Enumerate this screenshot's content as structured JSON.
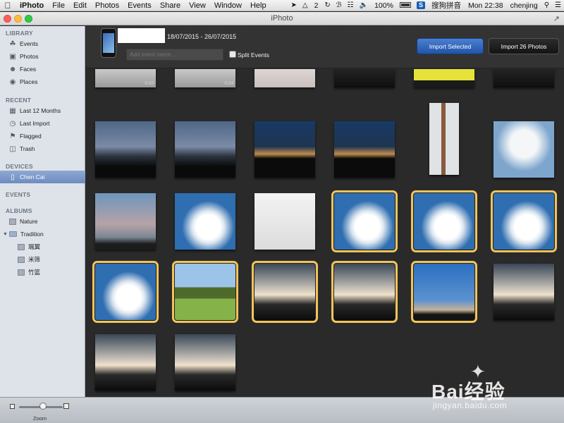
{
  "menubar": {
    "app_name": "iPhoto",
    "items": [
      "File",
      "Edit",
      "Photos",
      "Events",
      "Share",
      "View",
      "Window",
      "Help"
    ],
    "status_count": "2",
    "battery": "100%",
    "input_method": "搜狗拼音",
    "clock": "Mon 22:38",
    "user": "chenjing"
  },
  "window": {
    "title": "iPhoto"
  },
  "sidebar": {
    "library_heading": "LIBRARY",
    "library": [
      {
        "label": "Events",
        "icon": "palm-tree-icon"
      },
      {
        "label": "Photos",
        "icon": "photos-icon"
      },
      {
        "label": "Faces",
        "icon": "faces-icon"
      },
      {
        "label": "Places",
        "icon": "globe-icon"
      }
    ],
    "recent_heading": "RECENT",
    "recent": [
      {
        "label": "Last 12 Months",
        "icon": "calendar-icon"
      },
      {
        "label": "Last Import",
        "icon": "clock-icon"
      },
      {
        "label": "Flagged",
        "icon": "flag-icon"
      },
      {
        "label": "Trash",
        "icon": "trash-icon"
      }
    ],
    "devices_heading": "DEVICES",
    "device": "Chen Cai",
    "events_heading": "EVENTS",
    "albums_heading": "ALBUMS",
    "albums": [
      "Nature",
      "Tradition"
    ],
    "tradition_children": [
      "端翼",
      "米筛",
      "竹篮"
    ]
  },
  "header": {
    "date_range": "18/07/2015 - 26/07/2015",
    "event_placeholder": "Add event name...",
    "split_label": "Split Events",
    "import_selected": "Import Selected",
    "import_all": "Import 26 Photos"
  },
  "bottombar": {
    "zoom_label": "Zoom"
  },
  "photos": [
    {
      "selected": false,
      "palette": "grey",
      "badge": "0:10"
    },
    {
      "selected": false,
      "palette": "grey",
      "badge": "0:24"
    },
    {
      "selected": false,
      "palette": "paper",
      "badge": ""
    },
    {
      "selected": false,
      "palette": "dark-object",
      "badge": ""
    },
    {
      "selected": false,
      "palette": "yellow",
      "badge": ""
    },
    {
      "selected": false,
      "palette": "dark-object",
      "badge": ""
    },
    {
      "selected": false,
      "palette": "dusk",
      "badge": ""
    },
    {
      "selected": false,
      "palette": "dusk",
      "badge": ""
    },
    {
      "selected": false,
      "palette": "sunset-dark",
      "badge": ""
    },
    {
      "selected": false,
      "palette": "sunset-dark",
      "badge": ""
    },
    {
      "selected": false,
      "palette": "pole",
      "badge": ""
    },
    {
      "selected": false,
      "palette": "sky-clouds",
      "badge": ""
    },
    {
      "selected": false,
      "palette": "pale-sky",
      "badge": ""
    },
    {
      "selected": false,
      "palette": "cumulus",
      "badge": ""
    },
    {
      "selected": false,
      "palette": "notebook",
      "badge": ""
    },
    {
      "selected": true,
      "palette": "cumulus",
      "badge": ""
    },
    {
      "selected": true,
      "palette": "cumulus",
      "badge": ""
    },
    {
      "selected": true,
      "palette": "cumulus",
      "badge": ""
    },
    {
      "selected": true,
      "palette": "cumulus",
      "badge": ""
    },
    {
      "selected": true,
      "palette": "tree-grass",
      "badge": ""
    },
    {
      "selected": true,
      "palette": "storm",
      "badge": ""
    },
    {
      "selected": true,
      "palette": "storm",
      "badge": ""
    },
    {
      "selected": true,
      "palette": "blue-dusk",
      "badge": ""
    },
    {
      "selected": false,
      "palette": "storm",
      "badge": ""
    },
    {
      "selected": false,
      "palette": "storm",
      "badge": ""
    },
    {
      "selected": false,
      "palette": "storm",
      "badge": ""
    }
  ],
  "watermark": {
    "brand": "Bai经验",
    "url": "jingyan.baidu.com"
  }
}
